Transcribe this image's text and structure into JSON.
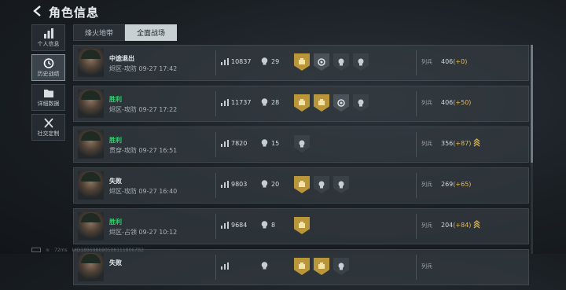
{
  "header": {
    "title": "角色信息"
  },
  "sidebar": {
    "items": [
      {
        "label": "个人信息",
        "icon": "bar-chart-icon",
        "active": false
      },
      {
        "label": "历史战绩",
        "icon": "clock-icon",
        "active": true
      },
      {
        "label": "详细数据",
        "icon": "folder-icon",
        "active": false
      },
      {
        "label": "社交定制",
        "icon": "tools-icon",
        "active": false
      }
    ]
  },
  "tabs": [
    {
      "label": "烽火地带",
      "active": false
    },
    {
      "label": "全面战场",
      "active": true
    }
  ],
  "rank_label": "列兵",
  "matches": [
    {
      "result": "中途退出",
      "mode": "烬区-攻防 09-27 17:42",
      "score": "10837",
      "kills": "29",
      "win": false,
      "badges": [
        "gold",
        "gray",
        "dark",
        "dark"
      ],
      "rank": "406",
      "delta": "(+0)",
      "chevrons": 0
    },
    {
      "result": "胜利",
      "mode": "烬区-攻防 09-27 17:22",
      "score": "11737",
      "kills": "28",
      "win": true,
      "badges": [
        "gold",
        "gold",
        "gray",
        "dark"
      ],
      "rank": "406",
      "delta": "(+50)",
      "chevrons": 0
    },
    {
      "result": "胜利",
      "mode": "贯穿-攻防 09-27 16:51",
      "score": "7820",
      "kills": "15",
      "win": true,
      "badges": [
        "dark"
      ],
      "rank": "356",
      "delta": "(+87)",
      "chevrons": 2
    },
    {
      "result": "失败",
      "mode": "烬区-攻防 09-27 16:40",
      "score": "9803",
      "kills": "20",
      "win": false,
      "badges": [
        "gold",
        "dark",
        "dark"
      ],
      "rank": "269",
      "delta": "(+65)",
      "chevrons": 0
    },
    {
      "result": "胜利",
      "mode": "烬区-占领 09-27 10:12",
      "score": "9684",
      "kills": "8",
      "win": true,
      "badges": [
        "gold"
      ],
      "rank": "204",
      "delta": "(+84)",
      "chevrons": 2
    },
    {
      "result": "失败",
      "mode": "",
      "score": "",
      "kills": "",
      "win": false,
      "badges": [
        "gold",
        "gold",
        "dark"
      ],
      "rank": "",
      "delta": "",
      "chevrons": 0
    }
  ],
  "status": {
    "ping": "72ms",
    "uid": "UID1896986905081118067B2"
  }
}
